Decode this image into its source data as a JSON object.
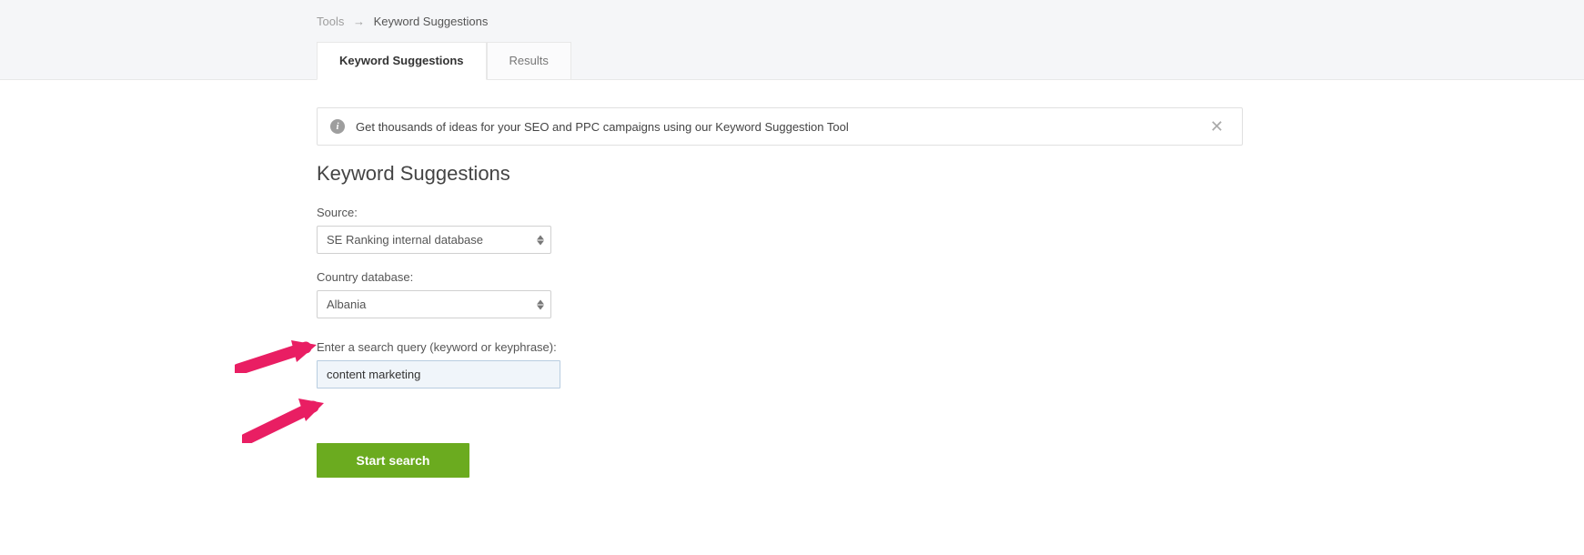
{
  "breadcrumb": {
    "root": "Tools",
    "current": "Keyword Suggestions"
  },
  "tabs": [
    {
      "label": "Keyword Suggestions",
      "active": true
    },
    {
      "label": "Results",
      "active": false
    }
  ],
  "banner": {
    "text": "Get thousands of ideas for your SEO and PPC campaigns using our Keyword Suggestion Tool"
  },
  "page_title": "Keyword Suggestions",
  "form": {
    "source_label": "Source:",
    "source_value": "SE Ranking internal database",
    "country_label": "Country database:",
    "country_value": "Albania",
    "query_label": "Enter a search query (keyword or keyphrase):",
    "query_value": "content marketing",
    "submit_label": "Start search"
  }
}
